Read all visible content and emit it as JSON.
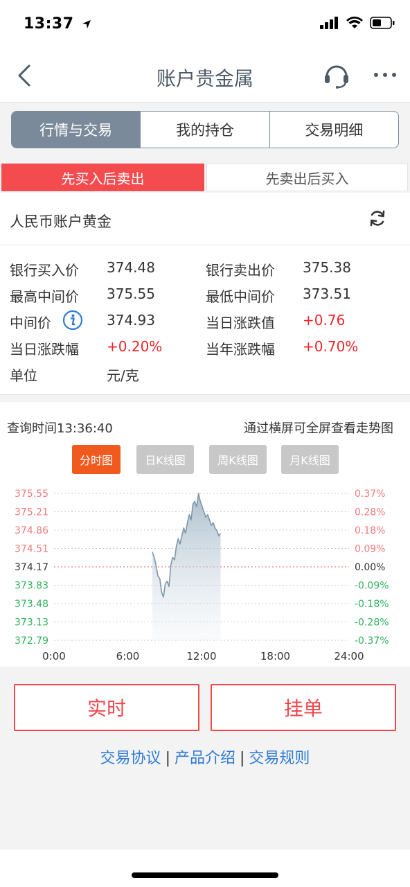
{
  "status_bar": {
    "time": "13:37"
  },
  "nav": {
    "title": "账户贵金属"
  },
  "segments": [
    {
      "label": "行情与交易",
      "active": true
    },
    {
      "label": "我的持仓",
      "active": false
    },
    {
      "label": "交易明细",
      "active": false
    }
  ],
  "trade_tabs": {
    "buy_first": "先买入后卖出",
    "sell_first": "先卖出后买入"
  },
  "product": {
    "name": "人民币账户黄金"
  },
  "quote": {
    "bank_buy_label": "银行买入价",
    "bank_buy": "374.48",
    "bank_sell_label": "银行卖出价",
    "bank_sell": "375.38",
    "high_mid_label": "最高中间价",
    "high_mid": "375.55",
    "low_mid_label": "最低中间价",
    "low_mid": "373.51",
    "mid_label": "中间价",
    "mid": "374.93",
    "day_change_label": "当日涨跌值",
    "day_change": "+0.76",
    "day_pct_label": "当日涨跌幅",
    "day_pct": "+0.20%",
    "year_pct_label": "当年涨跌幅",
    "year_pct": "+0.70%",
    "unit_label": "单位",
    "unit": "元/克"
  },
  "chart_header": {
    "query_time": "查询时间13:36:40",
    "landscape_tip": "通过横屏可全屏查看走势图"
  },
  "chart_tabs": [
    {
      "label": "分时图",
      "active": true
    },
    {
      "label": "日K线图",
      "active": false
    },
    {
      "label": "周K线图",
      "active": false
    },
    {
      "label": "月K线图",
      "active": false
    }
  ],
  "colors": {
    "up": "#f0262a",
    "down": "#2fb15e",
    "accent": "#f34b4e",
    "segment": "#7a8a9a",
    "link": "#2f7bd6"
  },
  "chart_data": {
    "type": "area",
    "y_left_ticks": [
      "375.55",
      "375.21",
      "374.86",
      "374.51",
      "374.17",
      "373.83",
      "373.48",
      "373.13",
      "372.79"
    ],
    "y_right_ticks": [
      "0.37%",
      "0.28%",
      "0.18%",
      "0.09%",
      "0.00%",
      "-0.09%",
      "-0.18%",
      "-0.28%",
      "-0.37%"
    ],
    "x_ticks": [
      "0:00",
      "6:00",
      "12:00",
      "18:00",
      "24:00"
    ],
    "xlim": [
      0,
      24
    ],
    "ylim": [
      372.79,
      375.55
    ],
    "base_price": 374.17,
    "series": [
      {
        "x": [
          8.0,
          8.15,
          8.3,
          8.45,
          8.6,
          8.75,
          8.9,
          9.05,
          9.2,
          9.35,
          9.5,
          9.65,
          9.8,
          9.95,
          10.1,
          10.25,
          10.4,
          10.55,
          10.7,
          10.85,
          11.0,
          11.15,
          11.3,
          11.45,
          11.6,
          11.75,
          11.9,
          12.05,
          12.2,
          12.35,
          12.5,
          12.65,
          12.8,
          12.95,
          13.1,
          13.25,
          13.4,
          13.55
        ],
        "y": [
          374.45,
          374.35,
          374.2,
          374.0,
          373.95,
          373.7,
          373.6,
          373.85,
          373.9,
          373.8,
          374.2,
          374.35,
          374.3,
          374.55,
          374.7,
          374.6,
          374.75,
          374.9,
          374.8,
          375.0,
          375.15,
          375.05,
          375.35,
          375.4,
          375.3,
          375.55,
          375.4,
          375.3,
          375.2,
          375.1,
          375.15,
          375.05,
          374.95,
          375.0,
          374.9,
          374.85,
          374.75,
          374.8
        ]
      }
    ]
  },
  "actions": {
    "realtime": "实时",
    "order": "挂单"
  },
  "links": {
    "agreement": "交易协议",
    "product_intro": "产品介绍",
    "rules": "交易规则",
    "sep": "|"
  }
}
